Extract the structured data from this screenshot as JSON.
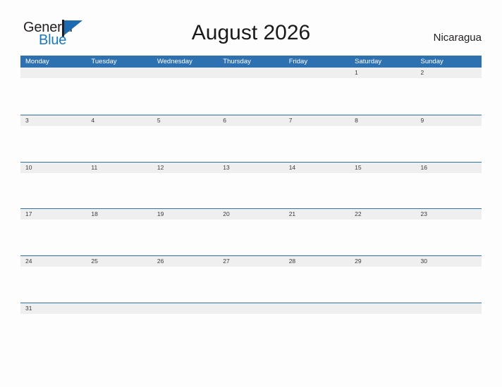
{
  "brand": {
    "name_top": "General",
    "name_bottom": "Blue",
    "logo_icon": "triangle-flag-icon",
    "accent_color": "#1f6bb0"
  },
  "header": {
    "title": "August 2026",
    "country": "Nicaragua"
  },
  "calendar": {
    "header_color": "#2e71b0",
    "date_strip_color": "#efefef",
    "weekdays": [
      "Monday",
      "Tuesday",
      "Wednesday",
      "Thursday",
      "Friday",
      "Saturday",
      "Sunday"
    ],
    "weeks": [
      [
        "",
        "",
        "",
        "",
        "",
        "1",
        "2"
      ],
      [
        "3",
        "4",
        "5",
        "6",
        "7",
        "8",
        "9"
      ],
      [
        "10",
        "11",
        "12",
        "13",
        "14",
        "15",
        "16"
      ],
      [
        "17",
        "18",
        "19",
        "20",
        "21",
        "22",
        "23"
      ],
      [
        "24",
        "25",
        "26",
        "27",
        "28",
        "29",
        "30"
      ],
      [
        "31",
        "",
        "",
        "",
        "",
        "",
        ""
      ]
    ]
  }
}
